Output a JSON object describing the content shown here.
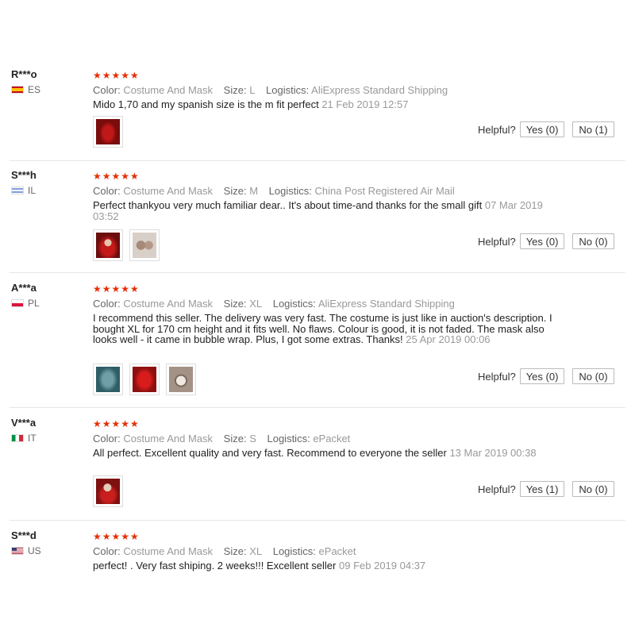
{
  "labels": {
    "color": "Color:",
    "size": "Size:",
    "logistics": "Logistics:",
    "helpful": "Helpful?"
  },
  "colors": {
    "stars": "#e62e04",
    "muted": "#999999"
  },
  "reviews": [
    {
      "user": "R***o",
      "country": "ES",
      "stars": "★★★★★",
      "color": "Costume And Mask",
      "size": "L",
      "logistics": "AliExpress Standard Shipping",
      "text": "Mido 1,70 and my spanish size is the m fit perfect",
      "date": "21 Feb 2019 12:57",
      "yes": "Yes (0)",
      "no": "No (1)",
      "photos": [
        "red-costume-photo"
      ]
    },
    {
      "user": "S***h",
      "country": "IL",
      "stars": "★★★★★",
      "color": "Costume And Mask",
      "size": "M",
      "logistics": "China Post Registered Air Mail",
      "text": "Perfect thankyou very much familiar dear.. It's about time-and thanks for the small gift",
      "date": "07 Mar 2019 03:52",
      "yes": "Yes (0)",
      "no": "No (0)",
      "photos": [
        "red-costume-photo",
        "mask-photo"
      ]
    },
    {
      "user": "A***a",
      "country": "PL",
      "stars": "★★★★★",
      "color": "Costume And Mask",
      "size": "XL",
      "logistics": "AliExpress Standard Shipping",
      "text": "I recommend this seller. The delivery was very fast. The costume is just like in auction's description. I bought XL for 170 cm height and it fits well. No flaws. Colour is good, it is not faded. The mask also looks well - it came in bubble wrap. Plus, I got some extras. Thanks!",
      "date": "25 Apr 2019 00:06",
      "yes": "Yes (0)",
      "no": "No (0)",
      "photos": [
        "package-photo",
        "red-costume-photo",
        "mask-photo"
      ]
    },
    {
      "user": "V***a",
      "country": "IT",
      "stars": "★★★★★",
      "color": "Costume And Mask",
      "size": "S",
      "logistics": "ePacket",
      "text": "All perfect. Excellent quality and very fast. Recommend to everyone the seller",
      "date": "13 Mar 2019 00:38",
      "yes": "Yes (1)",
      "no": "No (0)",
      "photos": [
        "red-costume-photo"
      ]
    },
    {
      "user": "S***d",
      "country": "US",
      "stars": "★★★★★",
      "color": "Costume And Mask",
      "size": "XL",
      "logistics": "ePacket",
      "text": "perfect! . Very fast shiping. 2 weeks!!! Excellent seller",
      "date": "09 Feb 2019 04:37",
      "yes": "",
      "no": "",
      "photos": []
    }
  ]
}
